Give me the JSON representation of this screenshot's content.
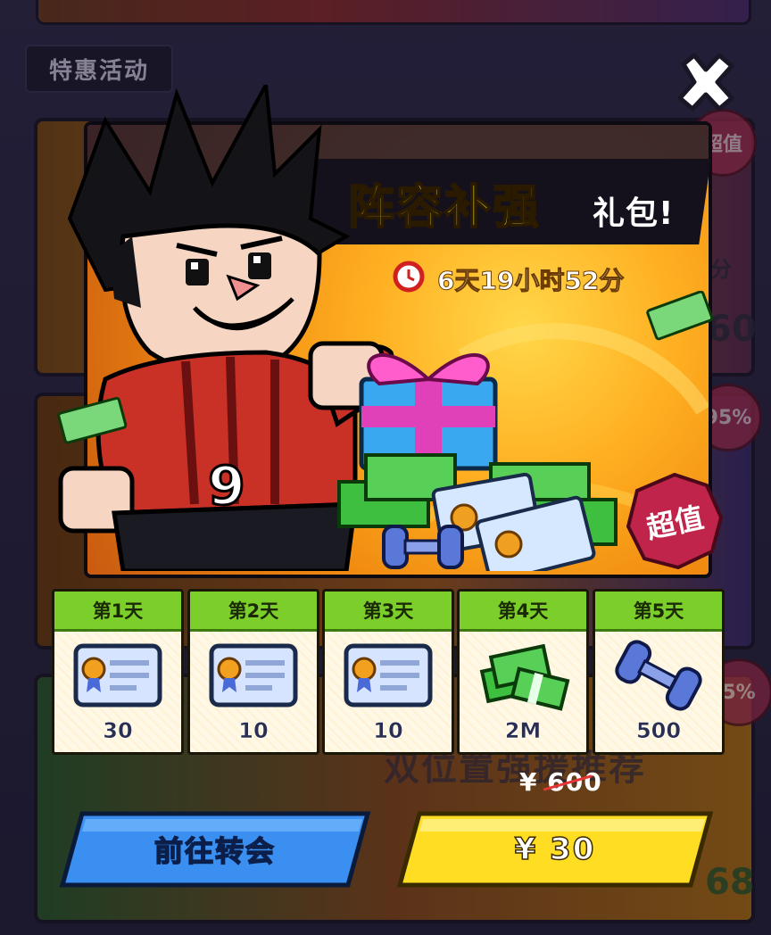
{
  "background": {
    "section_label": "特惠活动",
    "seal_1": "超值",
    "seal_2": "95%",
    "seal_3": "5%",
    "partial_text_1": "分",
    "partial_text_2": "60",
    "partial_text_3": "68",
    "bottom_banner_title": "双位置强援推荐"
  },
  "modal": {
    "title_main": "阵容补强",
    "title_sub": "礼包!",
    "timer": "6天19小时52分",
    "badge": "超值",
    "rewards": [
      {
        "day": "第1天",
        "icon": "ticket-icon",
        "qty": "30"
      },
      {
        "day": "第2天",
        "icon": "ticket-icon",
        "qty": "10"
      },
      {
        "day": "第3天",
        "icon": "ticket-icon",
        "qty": "10"
      },
      {
        "day": "第4天",
        "icon": "cash-stack-icon",
        "qty": "2M"
      },
      {
        "day": "第5天",
        "icon": "dumbbell-icon",
        "qty": "500"
      }
    ],
    "original_price": "¥ 600",
    "transfer_button": "前往转会",
    "buy_button": "¥ 30"
  },
  "colors": {
    "title": "#ffe53a",
    "day_header": "#7ccf2a",
    "buy_button": "#ffdd22",
    "transfer_button": "#3a8ff0",
    "badge": "#c0244a",
    "strike": "#e53535"
  }
}
